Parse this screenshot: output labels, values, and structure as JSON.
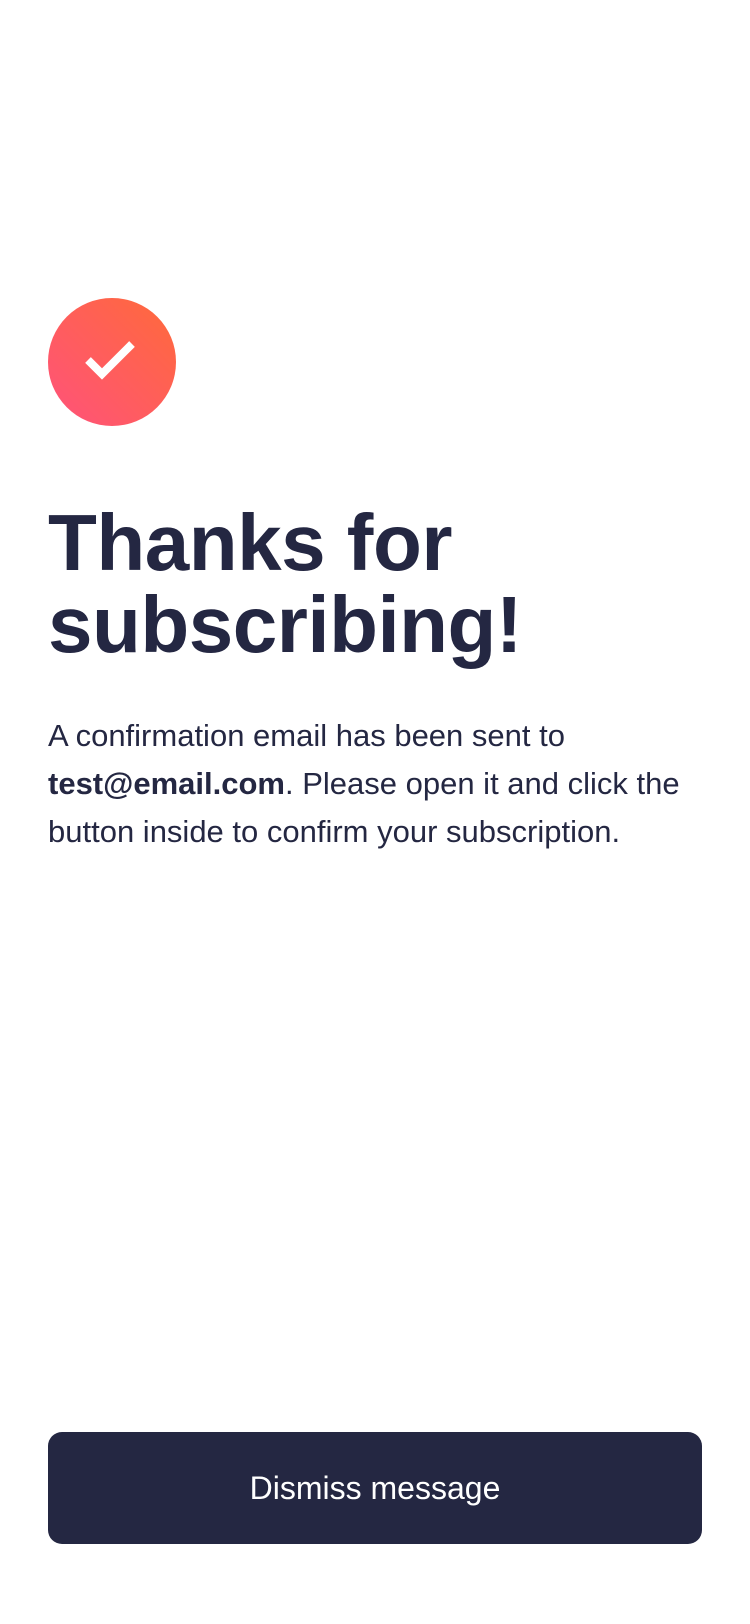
{
  "icon": {
    "name": "checkmark-icon",
    "gradient_start": "#ff6a3a",
    "gradient_end": "#ff527b"
  },
  "title": "Thanks for subscribing!",
  "message": {
    "line_start": "A confirmation email has been sent to ",
    "email": "test@email.com",
    "line_end": ". Please open it and click the button inside to confirm your subscription."
  },
  "dismiss_button": {
    "label": "Dismiss message",
    "background": "#242742",
    "text_color": "#ffffff"
  }
}
